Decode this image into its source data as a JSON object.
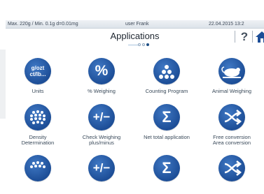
{
  "status": {
    "capacity": "Max. 220g / Min. 0.1g  d=0.01mg",
    "user": "user Frank",
    "datetime": "22.04.2015  13:2"
  },
  "header": {
    "title": "Applications",
    "help_label": "?",
    "pager": {
      "pages": 3,
      "current": 2
    }
  },
  "apps": [
    {
      "label": "Units",
      "icon": "units-icon",
      "glyph": "g/ozt ct/lb..."
    },
    {
      "label": "% Weighing",
      "icon": "percent-icon",
      "glyph": "%"
    },
    {
      "label": "Counting Program",
      "icon": "counting-dots-icon",
      "glyph": ""
    },
    {
      "label": "Animal Weighing",
      "icon": "mouse-icon",
      "glyph": ""
    },
    {
      "label": "Density Determination",
      "label_lines": [
        "Density",
        "Determination"
      ],
      "icon": "density-icon",
      "glyph": ""
    },
    {
      "label": "Check Weighing plus/minus",
      "label_lines": [
        "Check Weighing",
        "plus/minus"
      ],
      "icon": "plus-minus-icon",
      "glyph": "+/−"
    },
    {
      "label": "Net total application",
      "icon": "sigma-icon",
      "glyph": "Σ"
    },
    {
      "label": "Free conversion Area conversion",
      "label_lines": [
        "Free conversion",
        "Area conversion"
      ],
      "icon": "conversion-arrows-icon",
      "glyph": ""
    }
  ],
  "colors": {
    "accent": "#1d4e97",
    "status_bg": "#e3e8ee"
  }
}
